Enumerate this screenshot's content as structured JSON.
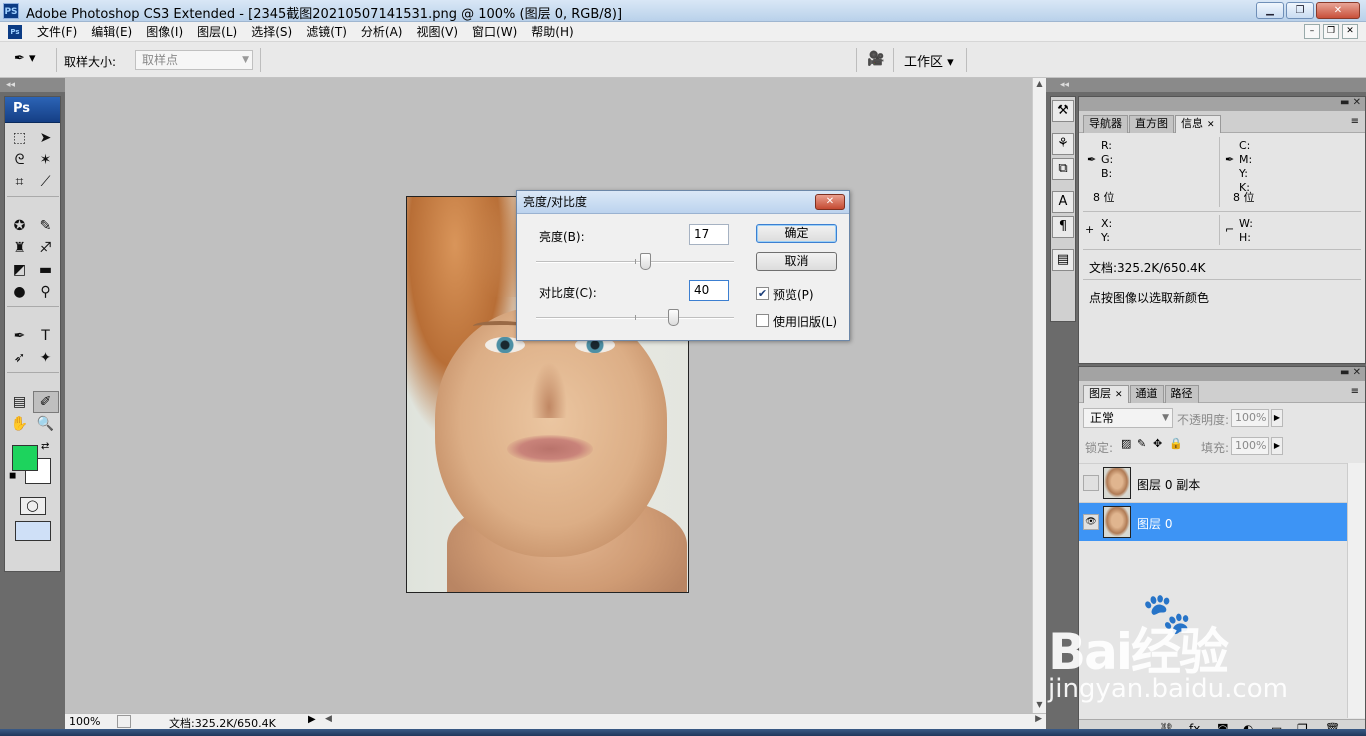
{
  "window": {
    "app_icon": "PS",
    "title": "Adobe Photoshop CS3 Extended - [2345截图20210507141531.png @ 100% (图层 0, RGB/8)]",
    "minimize": "▁",
    "maximize": "❐",
    "close": "✕"
  },
  "menu": {
    "items": [
      "文件(F)",
      "编辑(E)",
      "图像(I)",
      "图层(L)",
      "选择(S)",
      "滤镜(T)",
      "分析(A)",
      "视图(V)",
      "窗口(W)",
      "帮助(H)"
    ],
    "doc_buttons": [
      "–",
      "❐",
      "✕"
    ]
  },
  "options": {
    "sample_size_label": "取样大小:",
    "sample_size_value": "取样点",
    "workspace_label": "工作区 ▾"
  },
  "toolbox": {
    "header": "Ps",
    "foreground_color": "#1dd35d",
    "background_color": "#ffffff"
  },
  "status": {
    "zoom": "100%",
    "doc_info": "文档:325.2K/650.4K"
  },
  "dialog": {
    "title": "亮度/对比度",
    "brightness_label": "亮度(B):",
    "brightness_value": "17",
    "brightness_fraction": 0.55,
    "contrast_label": "对比度(C):",
    "contrast_value": "40",
    "contrast_fraction": 0.69,
    "ok_label": "确定",
    "cancel_label": "取消",
    "preview_label": "预览(P)",
    "preview_checked": true,
    "legacy_label": "使用旧版(L)",
    "legacy_checked": false
  },
  "info_panel": {
    "tabs": [
      "导航器",
      "直方图",
      "信息"
    ],
    "active_tab": "信息",
    "rgb": [
      "R:",
      "G:",
      "B:"
    ],
    "cmyk": [
      "C:",
      "M:",
      "Y:",
      "K:"
    ],
    "bits_left": "8 位",
    "bits_right": "8 位",
    "x_label": "X:",
    "y_label": "Y:",
    "w_label": "W:",
    "h_label": "H:",
    "doc_info": "文档:325.2K/650.4K",
    "hint": "点按图像以选取新颜色"
  },
  "layers_panel": {
    "tabs": [
      "图层",
      "通道",
      "路径"
    ],
    "active_tab": "图层",
    "blend_mode": "正常",
    "opacity_label": "不透明度:",
    "opacity_value": "100%",
    "lock_label": "锁定:",
    "fill_label": "填充:",
    "fill_value": "100%",
    "layers": [
      {
        "name": "图层 0 副本",
        "visible": false,
        "selected": false
      },
      {
        "name": "图层 0",
        "visible": true,
        "selected": true
      }
    ]
  },
  "watermark": {
    "brand": "Bai经验",
    "url": "jingyan.baidu.com"
  }
}
